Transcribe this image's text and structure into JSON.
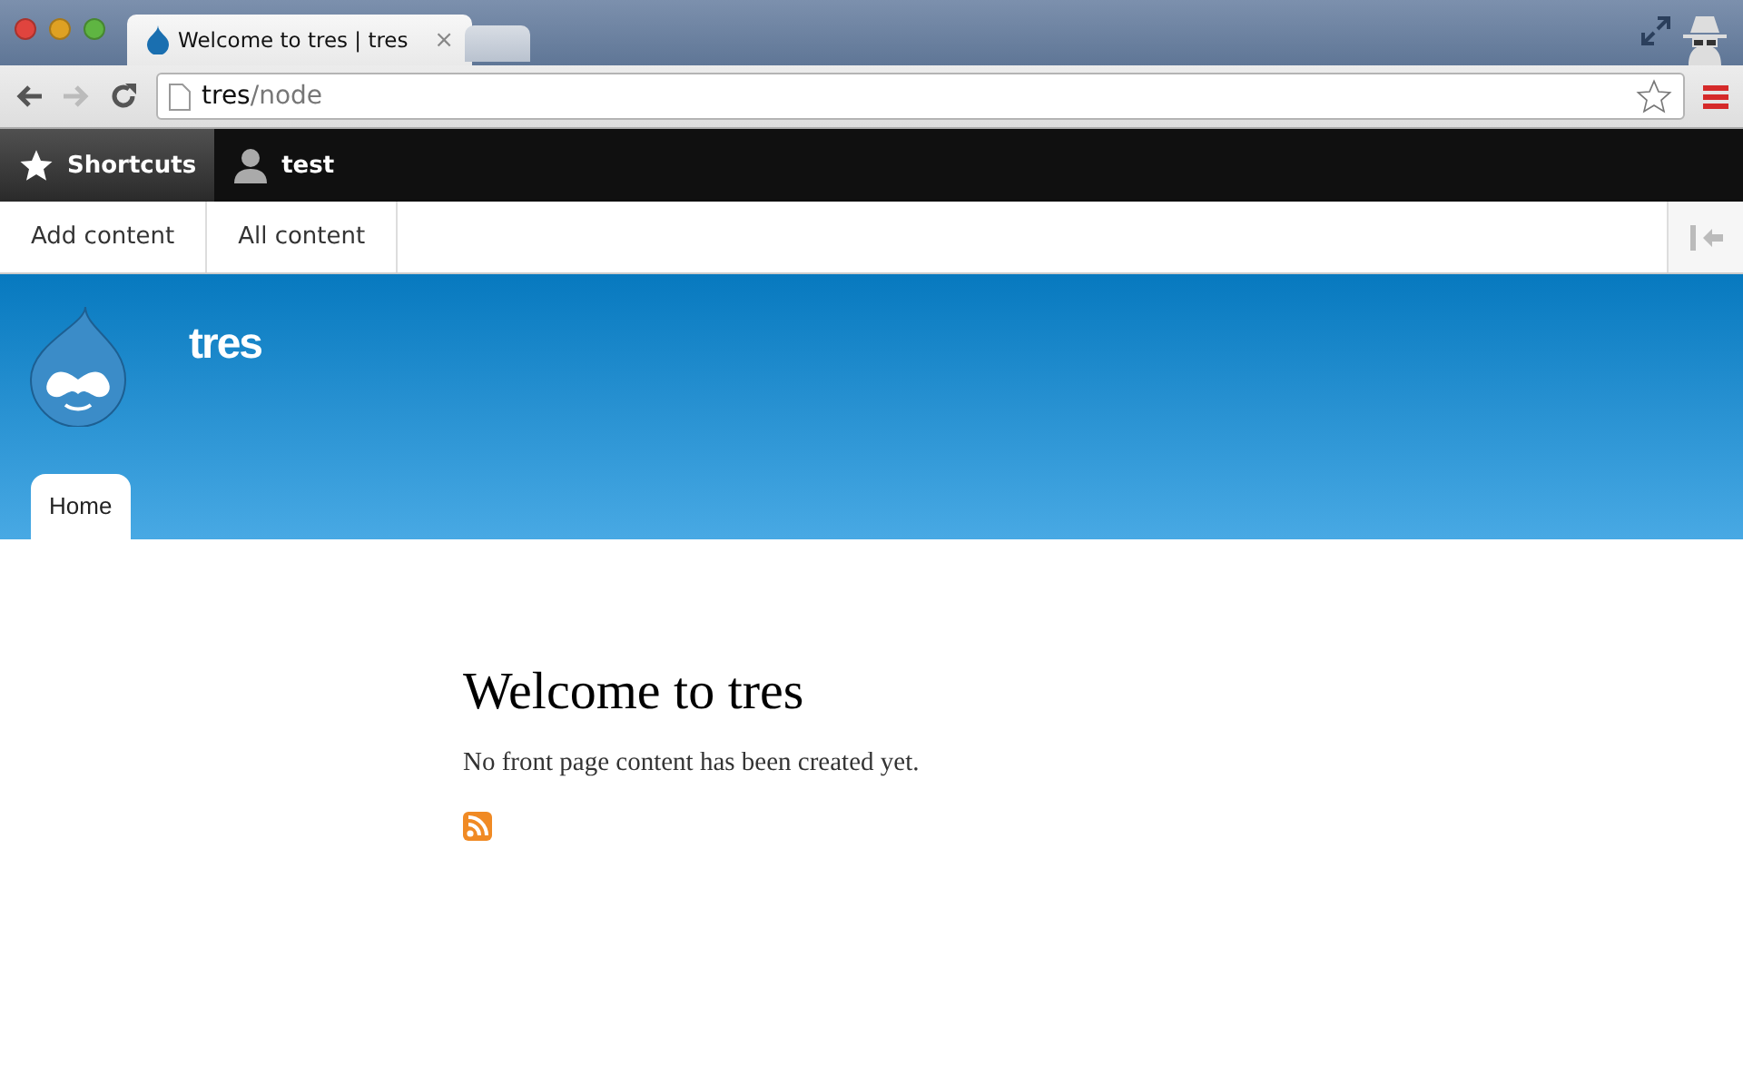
{
  "browser": {
    "tabs": [
      {
        "title": "Welcome to tres | tres",
        "selected": true,
        "close": "×"
      },
      {
        "selected": false
      }
    ],
    "address": {
      "host": "tres",
      "path": "/node"
    }
  },
  "toolbar": {
    "items": [
      {
        "label": "Shortcuts",
        "kind": "star",
        "selected": true
      },
      {
        "label": "test",
        "kind": "user",
        "selected": false
      }
    ]
  },
  "shortcuts": [
    "Add content",
    "All content"
  ],
  "site": {
    "name": "tres",
    "nav": [
      {
        "label": "Home",
        "selected": true
      }
    ]
  },
  "content": {
    "title": "Welcome to tres",
    "message": "No front page content has been created yet."
  }
}
